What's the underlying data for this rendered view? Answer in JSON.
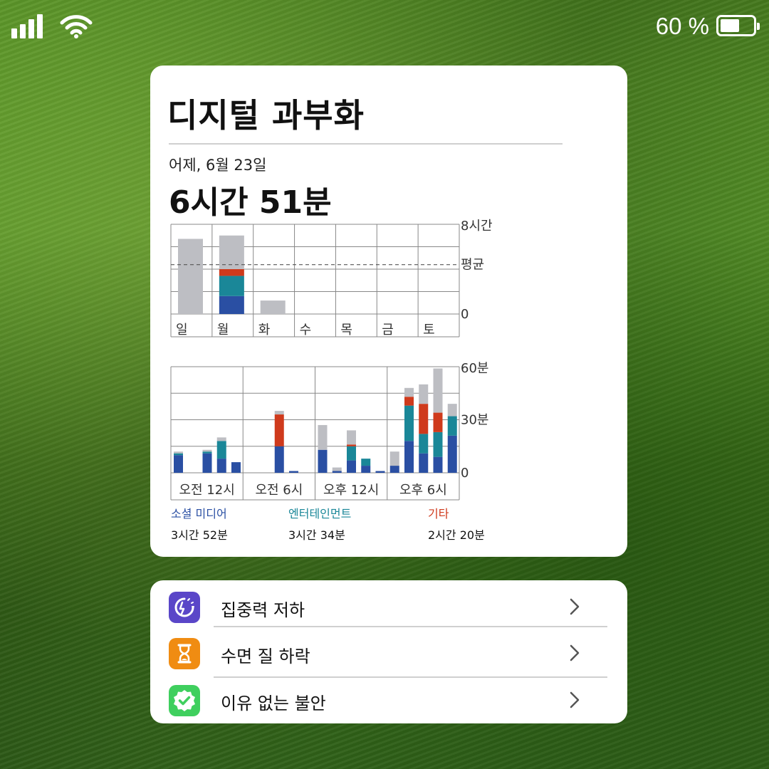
{
  "status_bar": {
    "battery_text": "60 %",
    "battery_level": 0.6,
    "icons": [
      "cellular-signal-icon",
      "wifi-icon",
      "battery-icon"
    ]
  },
  "card": {
    "title": "디지털 과부화",
    "date": "어제, 6월 23일",
    "total": "6시간 51분"
  },
  "colors": {
    "social": "#2a4fa3",
    "entertainment": "#1a8798",
    "other": "#cf3a1c",
    "neutral": "#bdbec3"
  },
  "chart_data": [
    {
      "type": "bar",
      "stacked": true,
      "categories": [
        "일",
        "월",
        "화",
        "수",
        "목",
        "금",
        "토"
      ],
      "y_ticks": [
        "8시간",
        "평균",
        "0"
      ],
      "ylim": [
        0,
        8
      ],
      "average": 4.4,
      "series": [
        {
          "key": "social",
          "values": [
            0,
            1.6,
            0,
            0,
            0,
            0,
            0
          ]
        },
        {
          "key": "entertainment",
          "values": [
            0,
            1.8,
            0,
            0,
            0,
            0,
            0
          ]
        },
        {
          "key": "other",
          "values": [
            0,
            0.6,
            0,
            0,
            0,
            0,
            0
          ]
        },
        {
          "key": "neutral",
          "values": [
            6.7,
            3.0,
            1.2,
            0,
            0,
            0,
            0
          ]
        }
      ],
      "grid": true
    },
    {
      "type": "bar",
      "stacked": true,
      "x_ticks": [
        "오전 12시",
        "오전 6시",
        "오후 12시",
        "오후 6시"
      ],
      "y_ticks": [
        "60분",
        "30분",
        "0"
      ],
      "ylim": [
        0,
        60
      ],
      "series": [
        {
          "key": "social",
          "values": [
            10,
            0,
            11,
            8,
            6,
            0,
            0,
            15,
            1,
            0,
            13,
            1,
            7,
            4,
            1,
            4,
            18,
            11,
            9,
            21
          ]
        },
        {
          "key": "entertainment",
          "values": [
            1,
            0,
            1,
            10,
            0,
            0,
            0,
            0,
            0,
            0,
            0,
            0,
            8,
            4,
            0,
            0,
            20,
            11,
            14,
            11
          ]
        },
        {
          "key": "other",
          "values": [
            0,
            0,
            0,
            0,
            0,
            0,
            0,
            18,
            0,
            0,
            0,
            0,
            1,
            0,
            0,
            0,
            5,
            17,
            11,
            0
          ]
        },
        {
          "key": "neutral",
          "values": [
            1,
            0,
            1,
            2,
            0,
            0,
            0,
            2,
            0,
            0,
            14,
            2,
            8,
            0,
            0,
            8,
            5,
            11,
            25,
            7
          ]
        }
      ],
      "legend": [
        {
          "key": "social",
          "label": "소셜 미디어",
          "value": "3시간 52분"
        },
        {
          "key": "entertainment",
          "label": "엔터테인먼트",
          "value": "3시간 34분"
        },
        {
          "key": "other",
          "label": "기타",
          "value": "2시간 20분"
        }
      ],
      "grid": true
    }
  ],
  "list": {
    "items": [
      {
        "label": "집중력 저하",
        "icon": "focus-drop-icon",
        "color": "#5a46c8"
      },
      {
        "label": "수면 질 하락",
        "icon": "hourglass-icon",
        "color": "#f08c12"
      },
      {
        "label": "이유 없는 불안",
        "icon": "badge-check-icon",
        "color": "#3fcf5e"
      }
    ]
  }
}
